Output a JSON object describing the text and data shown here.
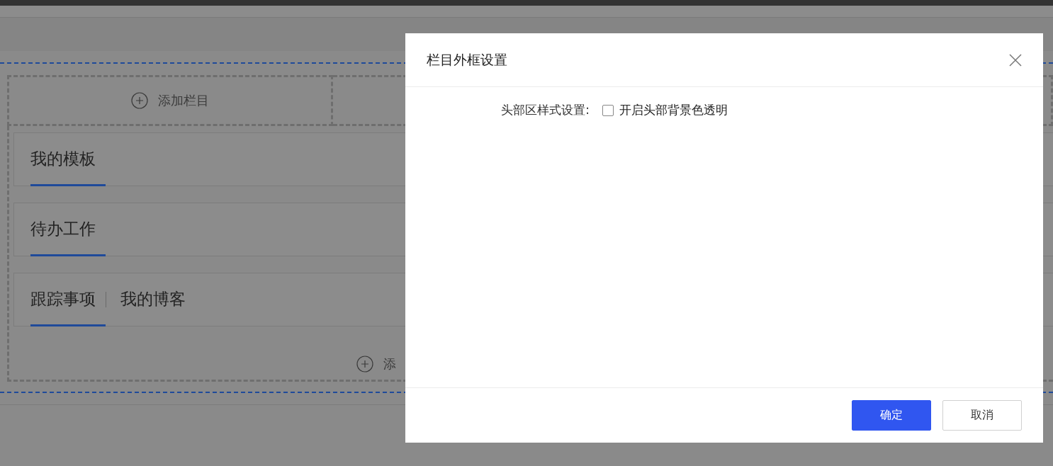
{
  "page": {
    "add_column_top": {
      "label": "添加栏目"
    },
    "columns": [
      {
        "tabs": [
          {
            "label": "我的模板",
            "selected": true
          }
        ]
      },
      {
        "tabs": [
          {
            "label": "待办工作",
            "selected": true
          }
        ]
      },
      {
        "tabs": [
          {
            "label": "跟踪事项",
            "selected": true
          },
          {
            "label": "我的博客",
            "selected": false
          }
        ]
      }
    ],
    "add_column_bottom": {
      "label": "添"
    }
  },
  "dialog": {
    "title": "栏目外框设置",
    "fields": [
      {
        "label": "头部区样式设置:",
        "checkbox": {
          "label": "开启头部背景色透明",
          "checked": false
        }
      }
    ],
    "buttons": [
      {
        "label": "确定",
        "kind": "primary"
      },
      {
        "label": "取消",
        "kind": "default"
      }
    ]
  }
}
